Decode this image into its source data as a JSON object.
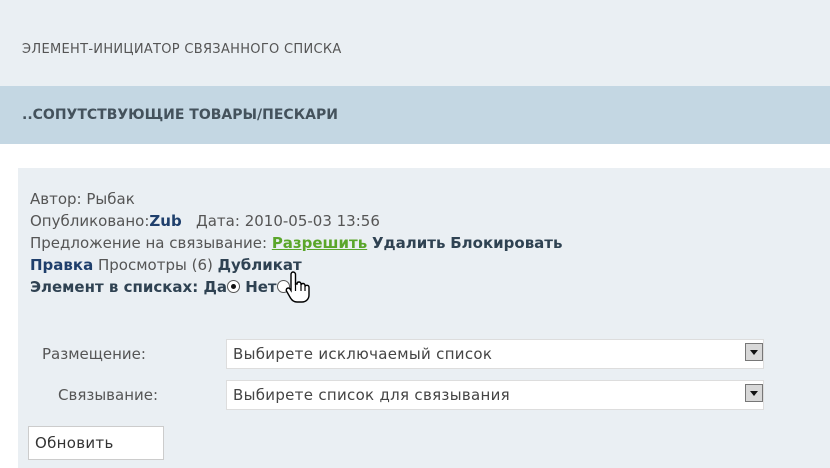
{
  "header": {
    "section_label": "элемент-инициатор связанного списка",
    "breadcrumb": "..СОПУТСТВУЮЩИЕ ТОВАРЫ/ПЕСКАРИ"
  },
  "details": {
    "author_label": "Автор:",
    "author_value": "Рыбак",
    "published_label": "Опубликовано:",
    "published_user": "Zub",
    "date_label": "Дата:",
    "date_value": "2010-05-03 13:56",
    "proposal_label": "Предложение на связывание:",
    "allow_link": "Разрешить",
    "delete_link": "Удалить",
    "block_link": "Блокировать",
    "edit_link": "Правка",
    "views_label": "Просмотры (6)",
    "duplicate_link": "Дубликат",
    "in_lists_label": "Элемент в списках:",
    "yes_label": "Да",
    "no_label": "Нет"
  },
  "form": {
    "placement_label": "Размещение:",
    "placement_value": "Выбирете исключаемый список",
    "linking_label": "Связывание:",
    "linking_value": "Выбирете список для связывания",
    "update_button": "Обновить"
  }
}
